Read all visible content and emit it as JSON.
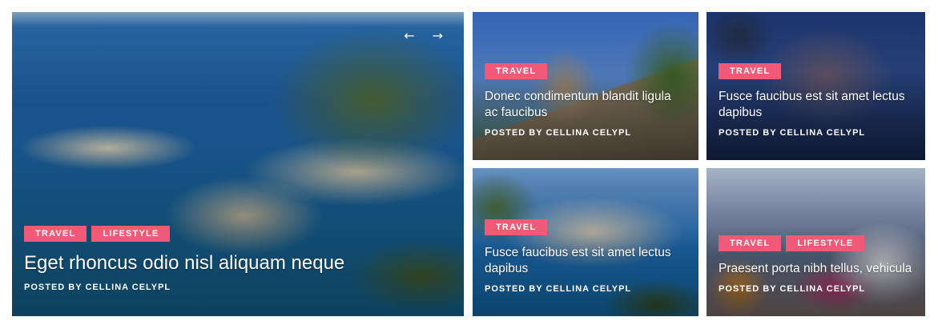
{
  "slider_nav": {
    "prev_icon": "←",
    "next_icon": "→"
  },
  "posts": [
    {
      "tags": [
        "TRAVEL",
        "LIFESTYLE"
      ],
      "title": "Eget rhoncus odio nisl aliquam neque",
      "meta_prefix": "POSTED BY",
      "author": "CELLINA CELYPL"
    },
    {
      "tags": [
        "TRAVEL"
      ],
      "title": "Donec condimentum blandit ligula ac faucibus",
      "meta_prefix": "POSTED BY",
      "author": "CELLINA CELYPL"
    },
    {
      "tags": [
        "TRAVEL"
      ],
      "title": "Fusce faucibus est sit amet lectus dapibus",
      "meta_prefix": "POSTED BY",
      "author": "CELLINA CELYPL"
    },
    {
      "tags": [
        "TRAVEL"
      ],
      "title": "Fusce faucibus est sit amet lectus dapibus",
      "meta_prefix": "POSTED BY",
      "author": "CELLINA CELYPL"
    },
    {
      "tags": [
        "TRAVEL",
        "LIFESTYLE"
      ],
      "title": "Praesent porta nibh tellus, vehicula",
      "meta_prefix": "POSTED BY",
      "author": "CELLINA CELYPL"
    }
  ],
  "colors": {
    "tag_bg": "#f05a78",
    "text": "#ffffff"
  }
}
